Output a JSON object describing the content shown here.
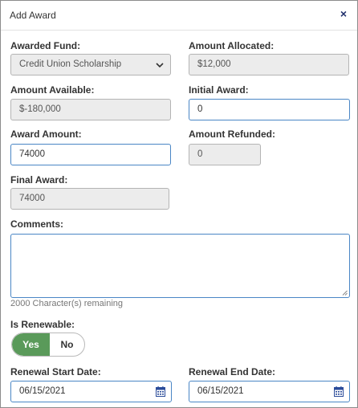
{
  "dialog": {
    "title": "Add Award",
    "close_glyph": "×"
  },
  "form": {
    "awarded_fund": {
      "label": "Awarded Fund:",
      "value": "Credit Union Scholarship"
    },
    "amount_allocated": {
      "label": "Amount Allocated:",
      "value": "$12,000"
    },
    "amount_available": {
      "label": "Amount Available:",
      "value": "$-180,000"
    },
    "initial_award": {
      "label": "Initial Award:",
      "value": "0"
    },
    "award_amount": {
      "label": "Award Amount:",
      "value": "74000"
    },
    "amount_refunded": {
      "label": "Amount Refunded:",
      "value": "0"
    },
    "final_award": {
      "label": "Final Award:",
      "value": "74000"
    },
    "comments": {
      "label": "Comments:",
      "value": "",
      "remaining": "2000 Character(s) remaining"
    },
    "is_renewable": {
      "label": "Is Renewable:",
      "yes": "Yes",
      "no": "No",
      "selected": "Yes"
    },
    "renewal_start_date": {
      "label": "Renewal Start Date:",
      "value": "06/15/2021"
    },
    "renewal_end_date": {
      "label": "Renewal End Date:",
      "value": "06/15/2021"
    }
  },
  "icons": {
    "close": "close-icon",
    "dropdown": "chevron-down-icon",
    "calendar": "calendar-icon",
    "resize": "resize-handle-icon"
  },
  "colors": {
    "field_border": "#4a86c5",
    "readonly_bg": "#ececec",
    "toggle_active": "#5a9a5a",
    "close_icon": "#1f2f6b",
    "calendar_icon": "#2b4c9a"
  }
}
